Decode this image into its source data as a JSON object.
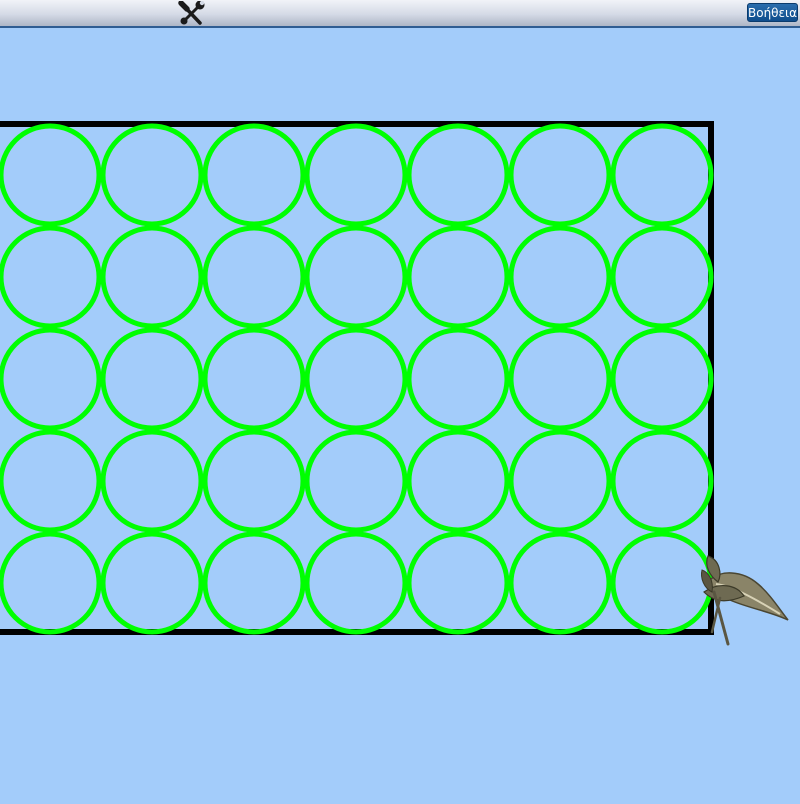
{
  "toolbar": {
    "tools_icon": "tools-icon",
    "help_label": "Βοήθεια"
  },
  "drawing": {
    "rows": 5,
    "columns": 7,
    "circle_color": "#00ff00",
    "frame_color": "#000000",
    "background_color": "#a3ccfa",
    "turtle_icon": "turtle-icon"
  }
}
